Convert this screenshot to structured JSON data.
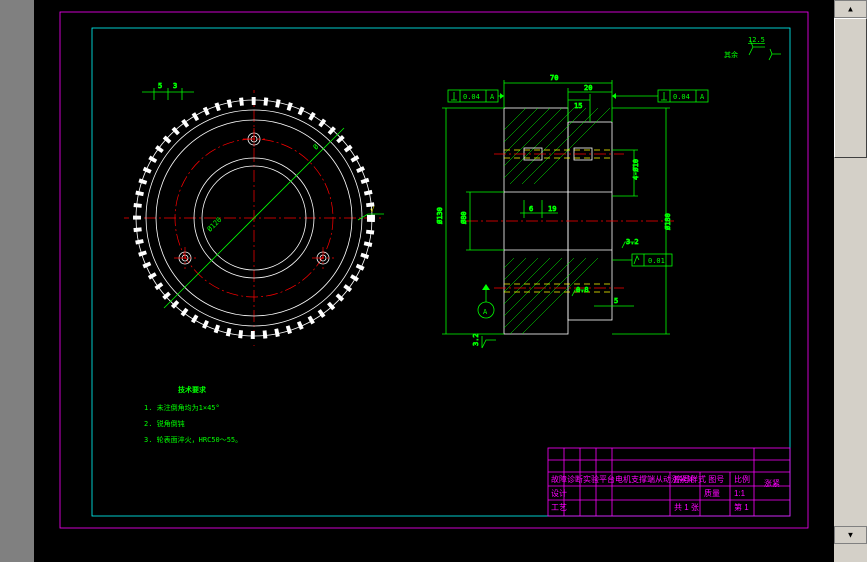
{
  "surface_note": {
    "label": "其余",
    "value": "12.5"
  },
  "dims": {
    "gear_top_5": "5",
    "gear_top_3": "3",
    "gear_diag_dia": "Ø ",
    "gear_bore": "Ø120",
    "gear_v_yf": "√",
    "sec_top_70": "70",
    "sec_top_20": "20",
    "sec_top_15": "15",
    "sec_gd_left_val": "0.04",
    "sec_gd_left_ref": "A",
    "sec_gd_right_val": "0.04",
    "sec_gd_right_ref": "A",
    "sec_left_diam": "Ø130",
    "sec_left_dia2": "Ø80",
    "sec_ctr_6": "6",
    "sec_ctr_19": "19",
    "sec_right_dia": "Ø180",
    "sec_right_phi": "4-Ø10",
    "sec_right_tri": "√",
    "sec_rr_val": "3.2",
    "sec_rr_fcf": "0.01",
    "sec_bot_08": "0.8",
    "sec_bot_5": "5",
    "sec_bl_32": "3.2",
    "datum_a": "A"
  },
  "tech": {
    "title": "技术要求",
    "item1": "1. 未注倒角均为1×45°",
    "item2": "2. 锐角倒钝",
    "item3": "3. 轮表面淬火，HRC50～55。"
  },
  "title_block": {
    "row1c1": "故障诊断实验平台电机支撑端从动涨紧轮",
    "row1c3": "序号样式 图号",
    "row1c4": "比例",
    "row1c5": "涨紧",
    "row2c1": "设计",
    "row2c3": "质量",
    "row2c4": "1:1",
    "row3c1": "工艺",
    "row3c3": "共 1 张",
    "row3c4": "第 1"
  }
}
